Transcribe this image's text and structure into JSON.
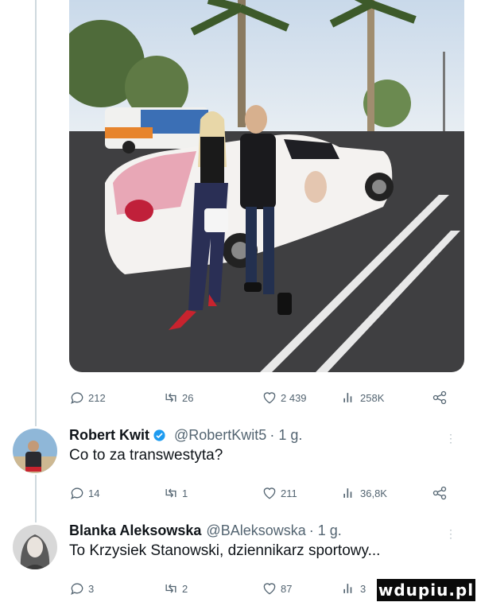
{
  "post": {
    "stats": {
      "replies": "212",
      "reposts": "26",
      "likes": "2 439",
      "views": "258K"
    }
  },
  "replies": [
    {
      "name": "Robert Kwit",
      "handle": "@RobertKwit5",
      "time": "· 1 g.",
      "text": "Co to za transwestyta?",
      "stats": {
        "replies": "14",
        "reposts": "1",
        "likes": "211",
        "views": "36,8K"
      }
    },
    {
      "name": "Blanka Aleksowska",
      "handle": "@BAleksowska",
      "time": "· 1 g.",
      "text": "To Krzysiek Stanowski, dziennikarz sportowy...",
      "stats": {
        "replies": "3",
        "reposts": "2",
        "likes": "87",
        "views": "3"
      }
    }
  ],
  "watermark": "wdupiu.pl",
  "colors": {
    "accent": "#1d9bf0",
    "muted": "#536471",
    "divider": "#cfd9de"
  }
}
